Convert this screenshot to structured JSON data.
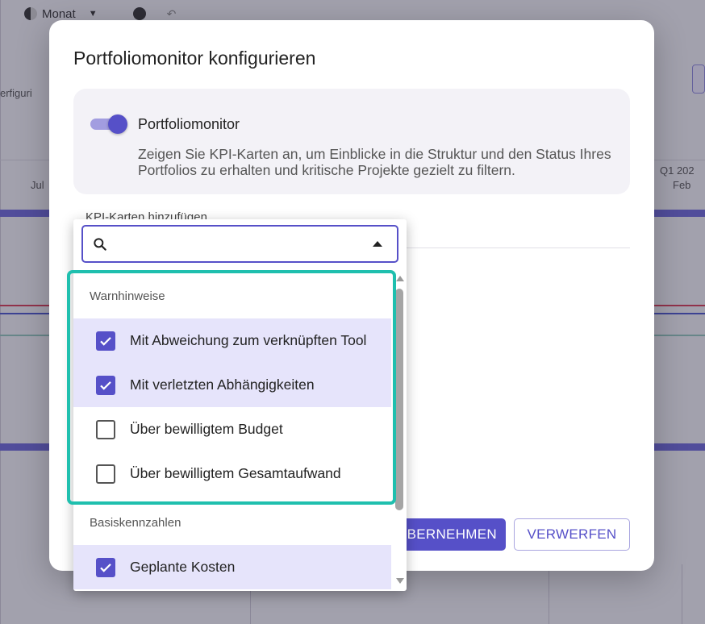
{
  "background": {
    "toolbar_view": "Monat",
    "left_text": "erfiguri",
    "col_label_left": "Jul",
    "col_label_right_top": "Q1 202",
    "col_label_right": "Feb"
  },
  "dialog": {
    "title": "Portfoliomonitor konfigurieren",
    "toggle": {
      "label": "Portfoliomonitor",
      "enabled": true,
      "description": "Zeigen Sie KPI-Karten an, um Einblicke in die Struktur und den Status Ihres Portfolios zu erhalten und kritische Projekte gezielt zu filtern."
    },
    "section_heading": "KPI-Karten hinzufügen",
    "buttons": {
      "apply": "ÜBERNEHMEN",
      "discard": "VERWERFEN"
    }
  },
  "dropdown": {
    "search_placeholder": "",
    "groups": [
      {
        "header": "Warnhinweise",
        "items": [
          {
            "label": "Mit Abweichung zum verknüpften Tool",
            "checked": true
          },
          {
            "label": "Mit verletzten Abhängigkeiten",
            "checked": true
          },
          {
            "label": "Über bewilligtem Budget",
            "checked": false
          },
          {
            "label": "Über bewilligtem Gesamtaufwand",
            "checked": false
          }
        ]
      },
      {
        "header": "Basiskennzahlen",
        "items": [
          {
            "label": "Geplante Kosten",
            "checked": true
          }
        ]
      }
    ]
  },
  "colors": {
    "accent": "#5650c8",
    "selected_row": "#e6e4fb",
    "highlight": "#1fbfae"
  }
}
